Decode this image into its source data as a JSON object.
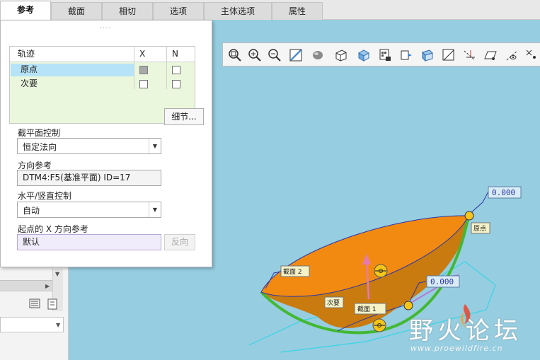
{
  "tabs": [
    {
      "label": "参考",
      "active": true
    },
    {
      "label": "截面",
      "active": false
    },
    {
      "label": "相切",
      "active": false
    },
    {
      "label": "选项",
      "active": false
    },
    {
      "label": "主体选项",
      "active": false
    },
    {
      "label": "属性",
      "active": false
    }
  ],
  "panel": {
    "grip": "....",
    "trajectory_table": {
      "headers": [
        "轨迹",
        "X",
        "N"
      ],
      "rows": [
        {
          "name": "原点",
          "x": "checked-grey",
          "n": false,
          "selected": true
        },
        {
          "name": "次要",
          "x": false,
          "n": false,
          "selected": false
        }
      ]
    },
    "details_button": "细节...",
    "section_plane_control": {
      "label": "截平面控制",
      "value": "恒定法向"
    },
    "direction_reference": {
      "label": "方向参考",
      "value": "DTM4:F5(基准平面) ID=17"
    },
    "horizontal_vertical_control": {
      "label": "水平/竖直控制",
      "value": "自动"
    },
    "start_x_direction_reference": {
      "label": "起点的 X 方向参考",
      "value": "默认",
      "flip_button": "反向"
    }
  },
  "viewport": {
    "labels": {
      "dim_top": "0.000",
      "dim_mid": "0.000",
      "origin": "原点",
      "secondary": "次要",
      "section1": "截面 1",
      "section2": "截面 2"
    },
    "colors": {
      "background": "#96cde0",
      "surface": "#f28a12",
      "edge": "#43b832",
      "handle": "#f5c518"
    }
  },
  "watermark": {
    "text": "野火论坛",
    "url": "www.proewildfire.cn"
  }
}
